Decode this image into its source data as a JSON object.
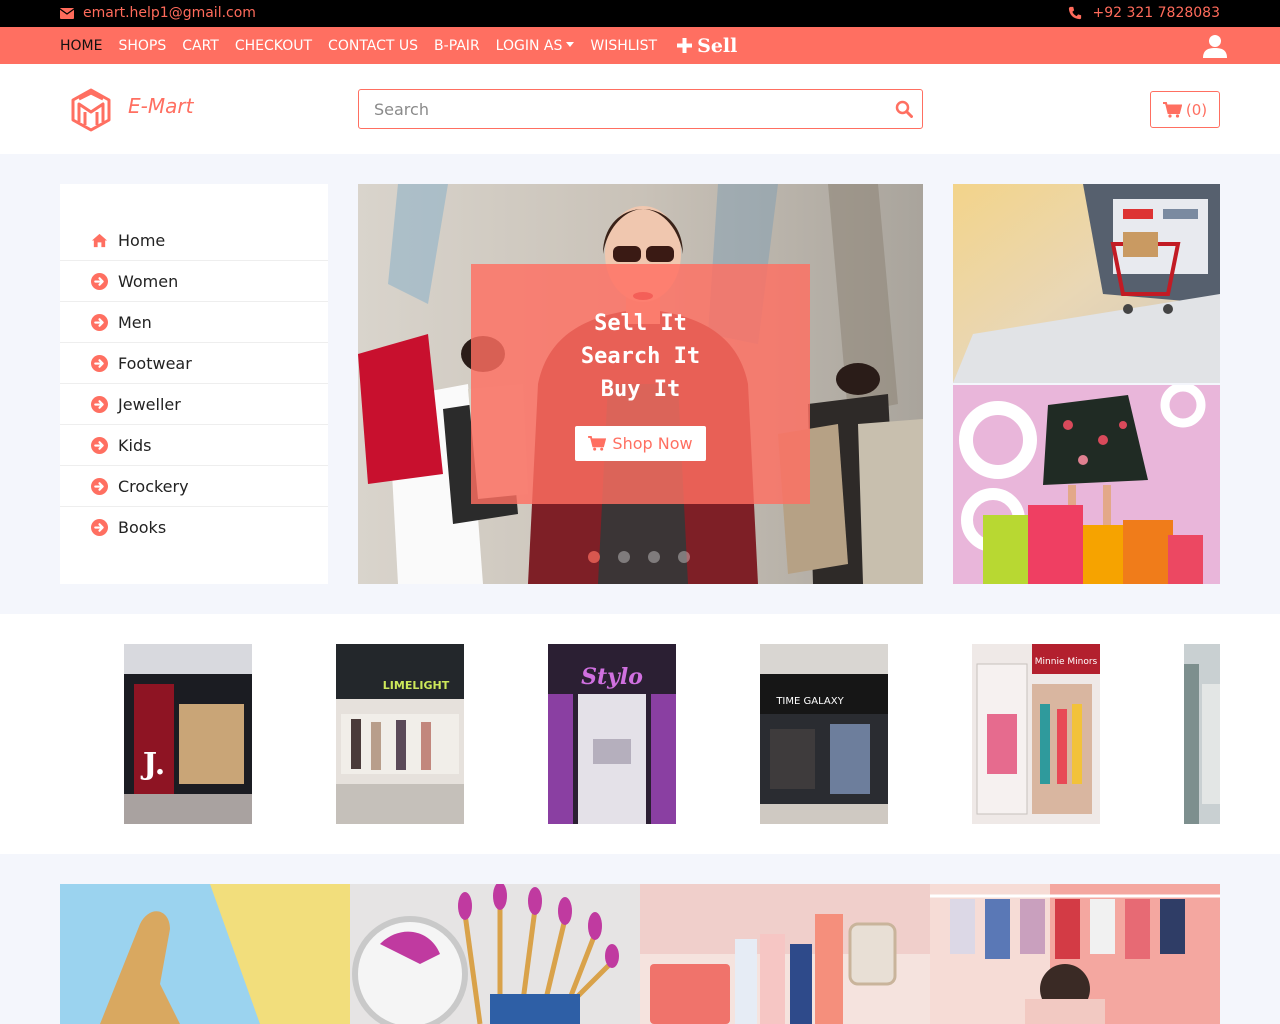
{
  "topbar": {
    "email": "emart.help1@gmail.com",
    "phone": "+92 321 7828083"
  },
  "nav": {
    "items": [
      "HOME",
      "SHOPS",
      "CART",
      "CHECKOUT",
      "CONTACT US",
      "B-PAIR",
      "LOGIN AS",
      "WISHLIST"
    ],
    "sell_label": "Sell"
  },
  "header": {
    "brand": "E-Mart",
    "search_placeholder": "Search",
    "cart_count": "(0)"
  },
  "sidebar": {
    "items": [
      "Home",
      "Women",
      "Men",
      "Footwear",
      "Jeweller",
      "Kids",
      "Crockery",
      "Books"
    ]
  },
  "hero": {
    "caption_lines": [
      "Sell It",
      "Search It",
      "Buy It"
    ],
    "button_label": "Shop Now",
    "slide_count": 4,
    "active_slide": 1
  },
  "shops": {
    "signs": [
      "J.",
      "LIMELIGHT",
      "Stylo",
      "TIME GALAXY",
      "Minnie Minors"
    ]
  },
  "colors": {
    "accent": "#ff6f61",
    "topbar": "#000000",
    "page_bg": "#f4f6fc"
  }
}
